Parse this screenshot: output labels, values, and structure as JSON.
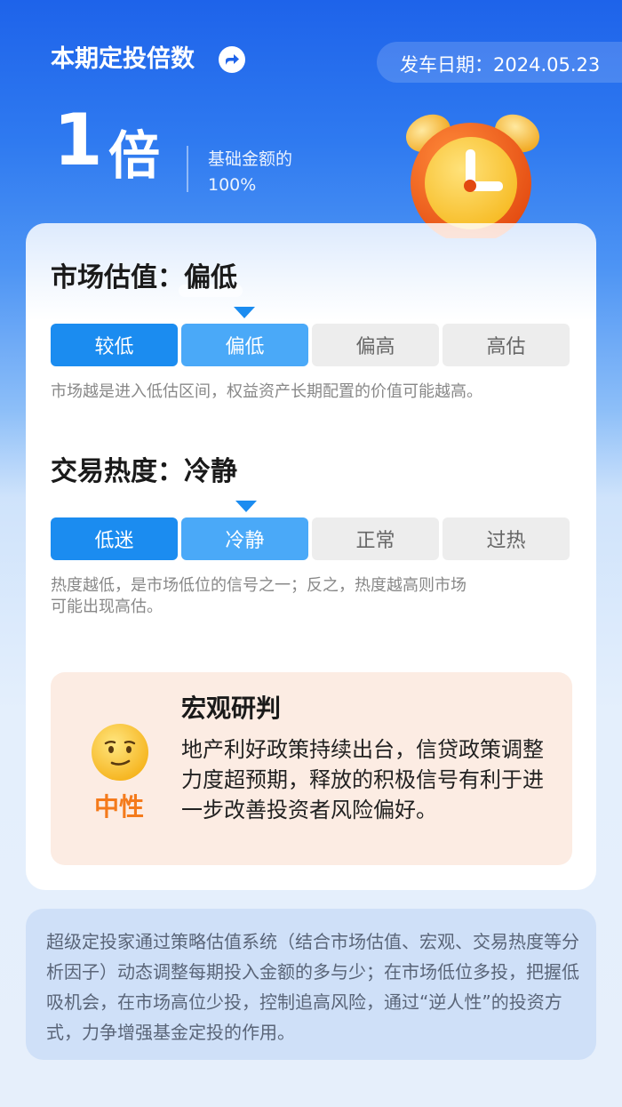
{
  "header": {
    "title": "本期定投倍数",
    "date_label": "发车日期：2024.05.23",
    "multiplier": "1",
    "multiplier_unit": "倍",
    "base_label": "基础金额的",
    "base_value": "100%"
  },
  "valuation": {
    "title_prefix": "市场估值：",
    "title_value": "偏低",
    "options": [
      "较低",
      "偏低",
      "偏高",
      "高估"
    ],
    "selected_index": 1,
    "description": "市场越是进入低估区间，权益资产长期配置的价值可能越高。"
  },
  "heat": {
    "title_prefix": "交易热度：",
    "title_value": "冷静",
    "options": [
      "低迷",
      "冷静",
      "正常",
      "过热"
    ],
    "selected_index": 1,
    "description_line1": "热度越低，是市场低位的信号之一；反之，热度越高则市场",
    "description_line2": "可能出现高估。"
  },
  "macro": {
    "title": "宏观研判",
    "sentiment": "中性",
    "sentiment_icon": "neutral-face-icon",
    "body": "地产利好政策持续出台，信贷政策调整力度超预期，释放的积极信号有利于进一步改善投资者风险偏好。"
  },
  "footer": {
    "text": "超级定投家通过策略估值系统（结合市场估值、宏观、交易热度等分析因子）动态调整每期投入金额的多与少；在市场低位多投，把握低吸机会，在市场高位少投，控制追高风险，通过“逆人性”的投资方式，力争增强基金定投的作用。"
  },
  "colors": {
    "accent_dark": "#1b8cf0",
    "accent_light": "#4aa9f8",
    "neutral_orange": "#f47a1b"
  }
}
